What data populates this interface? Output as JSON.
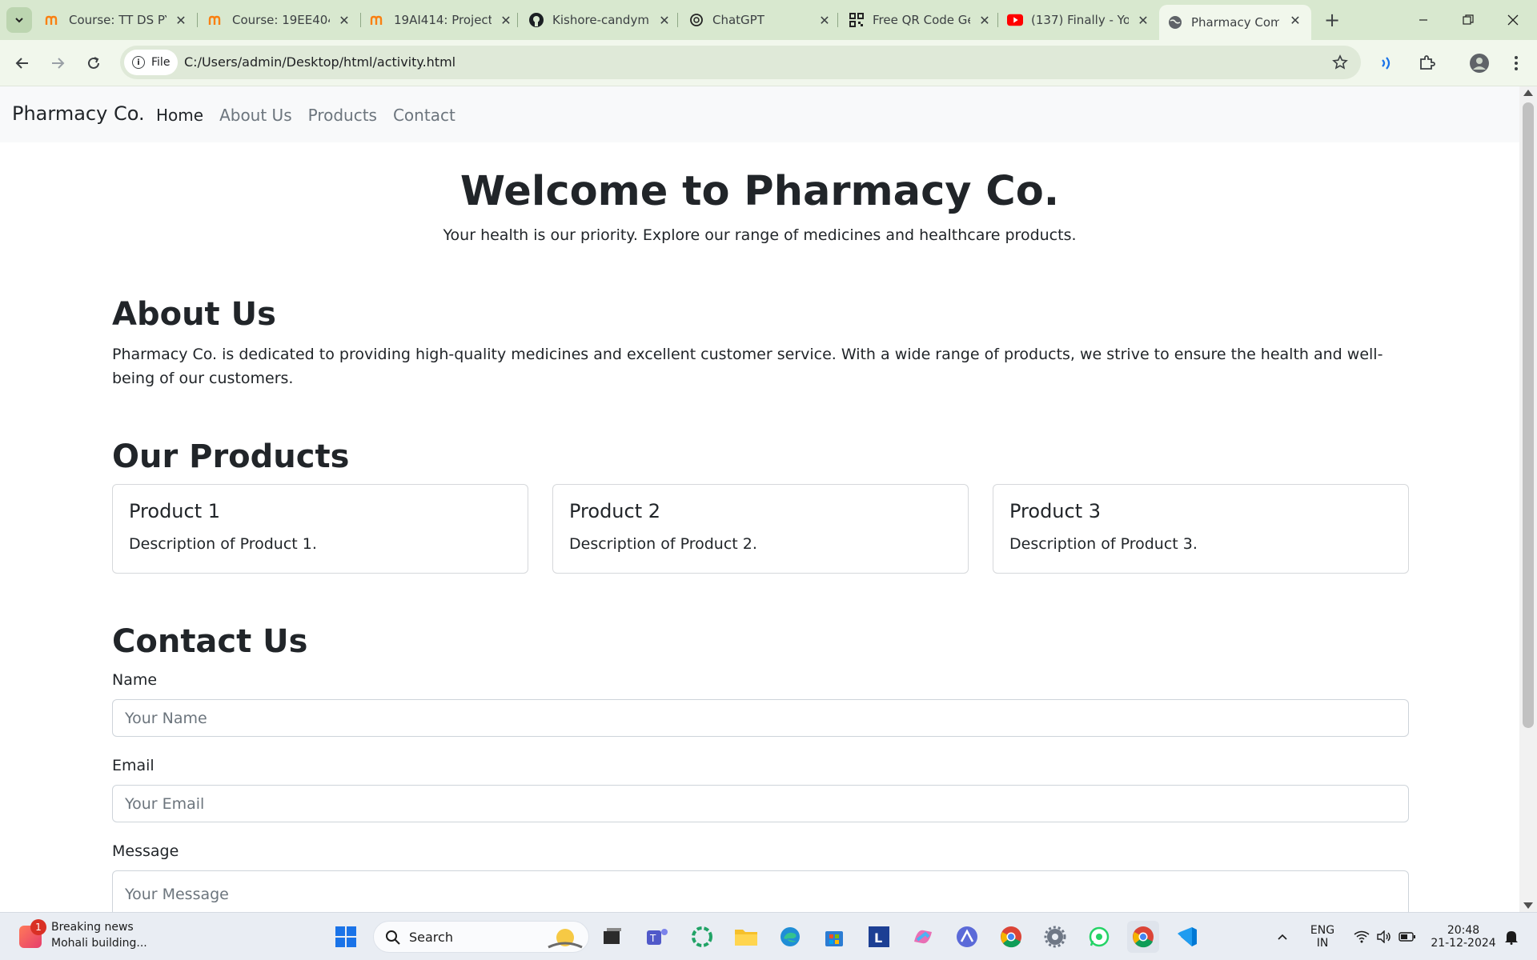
{
  "browser": {
    "tabs": [
      {
        "title": "Course: TT DS PY",
        "favicon": "moodle-icon"
      },
      {
        "title": "Course: 19EE404",
        "favicon": "moodle-icon"
      },
      {
        "title": "19AI414: Project",
        "favicon": "moodle-icon"
      },
      {
        "title": "Kishore-candyma",
        "favicon": "github-icon"
      },
      {
        "title": "ChatGPT",
        "favicon": "chatgpt-icon"
      },
      {
        "title": "Free QR Code Ge",
        "favicon": "qr-icon"
      },
      {
        "title": "(137) Finally - Yo",
        "favicon": "youtube-icon"
      },
      {
        "title": "Pharmacy Comp",
        "favicon": "globe-icon",
        "active": true
      }
    ],
    "address": {
      "chip_label": "File",
      "url": "C:/Users/admin/Desktop/html/activity.html"
    }
  },
  "page": {
    "brand": "Pharmacy Co.",
    "nav": [
      "Home",
      "About Us",
      "Products",
      "Contact"
    ],
    "hero": {
      "title": "Welcome to Pharmacy Co.",
      "subtitle": "Your health is our priority. Explore our range of medicines and healthcare products."
    },
    "about": {
      "heading": "About Us",
      "text": "Pharmacy Co. is dedicated to providing high-quality medicines and excellent customer service. With a wide range of products, we strive to ensure the health and well-being of our customers."
    },
    "products": {
      "heading": "Our Products",
      "items": [
        {
          "title": "Product 1",
          "text": "Description of Product 1."
        },
        {
          "title": "Product 2",
          "text": "Description of Product 2."
        },
        {
          "title": "Product 3",
          "text": "Description of Product 3."
        }
      ]
    },
    "contact": {
      "heading": "Contact Us",
      "name_label": "Name",
      "name_placeholder": "Your Name",
      "email_label": "Email",
      "email_placeholder": "Your Email",
      "message_label": "Message",
      "message_placeholder": "Your Message"
    }
  },
  "taskbar": {
    "news_badge": "1",
    "news_title": "Breaking news",
    "news_sub": "Mohali building...",
    "search_label": "Search",
    "lang_top": "ENG",
    "lang_bottom": "IN",
    "time": "20:48",
    "date": "21-12-2024"
  },
  "colors": {
    "tabstrip": "#d8e8cf",
    "toolbar": "#f1f7ec",
    "navbar_bg": "#f8f9fa",
    "text": "#212529",
    "muted": "#6c757d"
  }
}
